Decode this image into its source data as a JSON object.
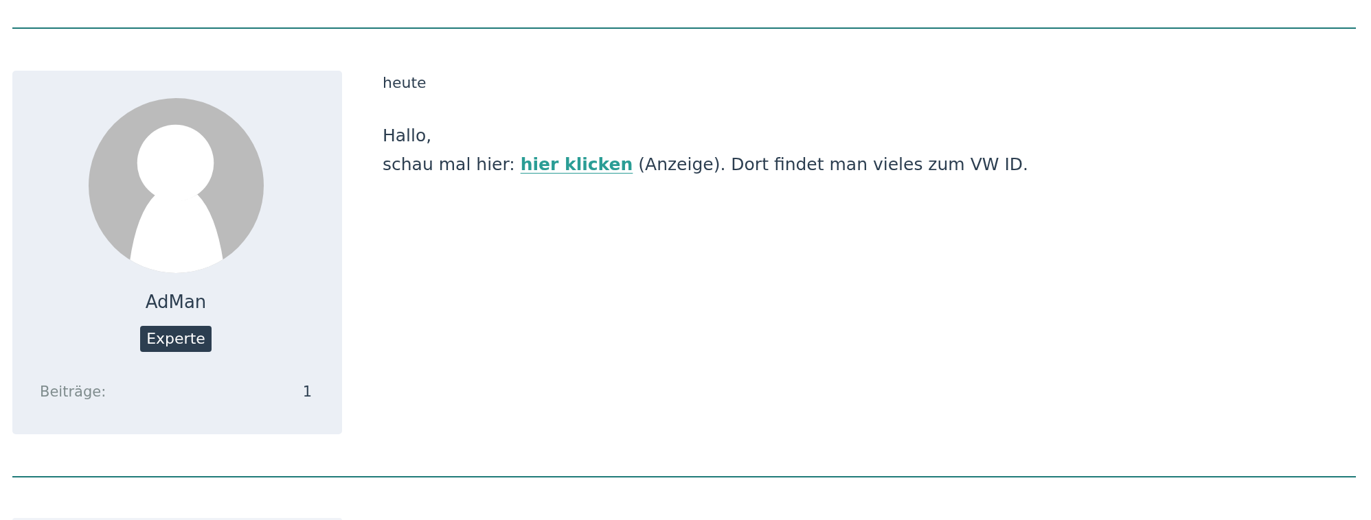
{
  "post": {
    "author": {
      "name": "AdMan",
      "rank": "Experte",
      "stats": [
        {
          "label": "Beiträge:",
          "value": "1"
        }
      ]
    },
    "date": "heute",
    "message": {
      "greeting": "Hallo,",
      "before_link": "schau mal hier:",
      "link": "hier klicken",
      "after_link": "(Anzeige). Dort findet man vieles zum VW ID."
    }
  }
}
